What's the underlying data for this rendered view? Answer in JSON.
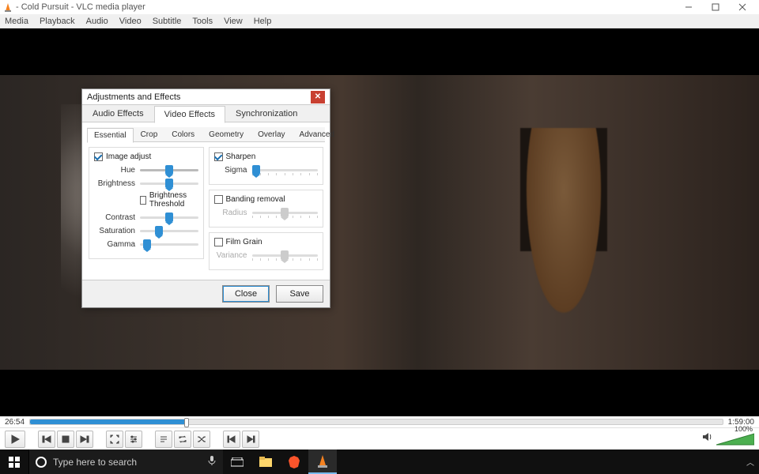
{
  "window": {
    "title": "- Cold Pursuit - VLC media player"
  },
  "menubar": {
    "items": [
      "Media",
      "Playback",
      "Audio",
      "Video",
      "Subtitle",
      "Tools",
      "View",
      "Help"
    ]
  },
  "playback": {
    "elapsed": "26:54",
    "total": "1:59:00",
    "volume_pct": "100%"
  },
  "dialog": {
    "title": "Adjustments and Effects",
    "main_tabs": {
      "audio": "Audio Effects",
      "video": "Video Effects",
      "sync": "Synchronization"
    },
    "sub_tabs": {
      "essential": "Essential",
      "crop": "Crop",
      "colors": "Colors",
      "geometry": "Geometry",
      "overlay": "Overlay",
      "advanced": "Advanced"
    },
    "image_adjust": {
      "label": "Image adjust",
      "hue": "Hue",
      "brightness": "Brightness",
      "brightness_threshold": "Brightness Threshold",
      "contrast": "Contrast",
      "saturation": "Saturation",
      "gamma": "Gamma"
    },
    "sharpen": {
      "label": "Sharpen",
      "sigma": "Sigma"
    },
    "banding": {
      "label": "Banding removal",
      "radius": "Radius"
    },
    "film_grain": {
      "label": "Film Grain",
      "variance": "Variance"
    },
    "buttons": {
      "close": "Close",
      "save": "Save"
    }
  },
  "taskbar": {
    "search_placeholder": "Type here to search"
  }
}
